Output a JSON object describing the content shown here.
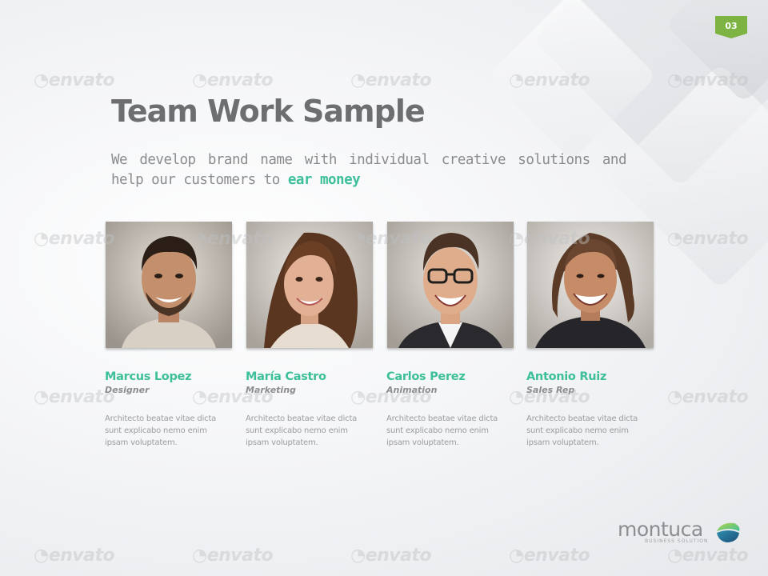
{
  "slide": {
    "page_number": "03",
    "title": "Team Work Sample",
    "subtitle": {
      "text": "We develop brand name with individual creative solutions and help our customers to",
      "highlight": "ear money"
    },
    "accent_color": "#3dbf9a",
    "badge_color": "#7cb342"
  },
  "team": [
    {
      "name": "Marcus Lopez",
      "role": "Designer",
      "description": "Architecto beatae vitae dicta sunt explicabo nemo enim ipsam voluptatem.",
      "photo": "man-smiling-portrait"
    },
    {
      "name": "María Castro",
      "role": "Marketing",
      "description": "Architecto beatae vitae dicta sunt explicabo nemo enim ipsam voluptatem.",
      "photo": "woman-smiling-portrait"
    },
    {
      "name": "Carlos Perez",
      "role": "Animation",
      "description": "Architecto beatae vitae dicta sunt explicabo nemo enim ipsam voluptatem.",
      "photo": "man-glasses-laughing-portrait"
    },
    {
      "name": "Antonio Ruiz",
      "role": "Sales Rep",
      "description": "Architecto beatae vitae dicta sunt explicabo nemo enim ipsam voluptatem.",
      "photo": "man-long-hair-laughing-portrait"
    }
  ],
  "logo": {
    "name": "montuca",
    "tagline": "BUSINESS SOLUTION"
  },
  "watermark": "envato"
}
